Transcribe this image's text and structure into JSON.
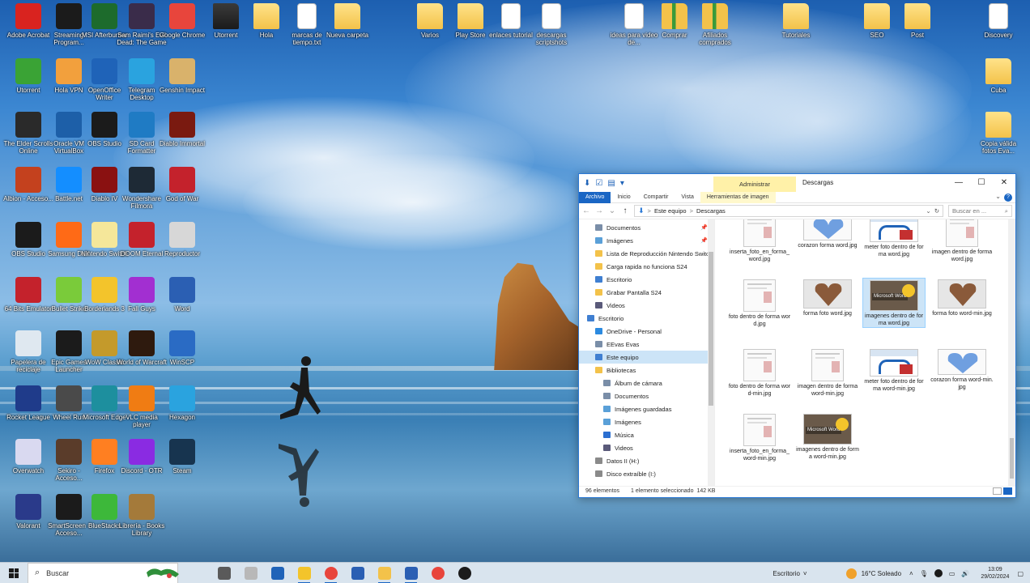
{
  "desktop_icons": [
    {
      "label": "Adobe Acrobat",
      "icon": "acrobat-icon",
      "color": "#d9231f"
    },
    {
      "label": "Streaming Program...",
      "icon": "streaming-icon",
      "color": "#1b1b1b"
    },
    {
      "label": "MSI Afterburner",
      "icon": "msi-afterburner-icon",
      "color": "#1d6b2c"
    },
    {
      "label": "Sam Raimi's Evil Dead: The Game",
      "icon": "game-icon",
      "color": "#3a2c4a"
    },
    {
      "label": "Google Chrome",
      "icon": "chrome-icon",
      "color": "#e8453c"
    },
    {
      "label": "Utorrent",
      "icon": "utorrent-icon",
      "color": "#3aa335"
    },
    {
      "label": "Hola VPN",
      "icon": "hola-icon",
      "color": "#f2a03d"
    },
    {
      "label": "OpenOffice Writer",
      "icon": "openoffice-icon",
      "color": "#1f63b8"
    },
    {
      "label": "Telegram Desktop",
      "icon": "telegram-icon",
      "color": "#2aa3df"
    },
    {
      "label": "Genshin Impact",
      "icon": "genshin-icon",
      "color": "#d9b26b"
    },
    {
      "label": "The Elder Scrolls Online",
      "icon": "eso-icon",
      "color": "#2a2a2a"
    },
    {
      "label": "Oracle VM VirtualBox",
      "icon": "virtualbox-icon",
      "color": "#1d5fa8"
    },
    {
      "label": "OBS Studio",
      "icon": "obs-icon",
      "color": "#1b1b1b"
    },
    {
      "label": "SD Card Formatter",
      "icon": "sd-card-icon",
      "color": "#1f7bc4"
    },
    {
      "label": "Diablo Immortal",
      "icon": "diablo-icon",
      "color": "#7a1a10"
    },
    {
      "label": "Albion - Acceso...",
      "icon": "albion-icon",
      "color": "#c4411e"
    },
    {
      "label": "Battle.net",
      "icon": "battlenet-icon",
      "color": "#148eff"
    },
    {
      "label": "Diablo IV",
      "icon": "diablo-iv-icon",
      "color": "#8a1111"
    },
    {
      "label": "Wondershare Filmora",
      "icon": "filmora-icon",
      "color": "#1e2a36"
    },
    {
      "label": "God of War",
      "icon": "god-of-war-icon",
      "color": "#c4222c"
    },
    {
      "label": "OBS Studio",
      "icon": "obs-studio-icon",
      "color": "#1b1b1b"
    },
    {
      "label": "Samsung DeX",
      "icon": "dex-icon",
      "color": "#ff6a16"
    },
    {
      "label": "Nintendo Switch",
      "icon": "switch-icon",
      "color": "#f5e79a"
    },
    {
      "label": "DOOM Eternal",
      "icon": "doom-icon",
      "color": "#c4222c"
    },
    {
      "label": "Reproductor",
      "icon": "cd-icon",
      "color": "#d7d7d7"
    },
    {
      "label": "64 Bits Emulator",
      "icon": "emulator-64-icon",
      "color": "#c4222c"
    },
    {
      "label": "Bullet Strike",
      "icon": "cube-icon",
      "color": "#7acb3a"
    },
    {
      "label": "Borderlands 3",
      "icon": "borderlands-icon",
      "color": "#f3c42b"
    },
    {
      "label": "Fall Guys",
      "icon": "fall-guys-icon",
      "color": "#a22fd1"
    },
    {
      "label": "Word",
      "icon": "word-icon",
      "color": "#2b5fb3"
    },
    {
      "label": "Papelera de reciclaje",
      "icon": "recycle-bin-icon",
      "color": "#dfe8f0"
    },
    {
      "label": "Epic Games Launcher",
      "icon": "epic-games-icon",
      "color": "#1b1b1b"
    },
    {
      "label": "WoW Classic",
      "icon": "wow-icon",
      "color": "#c49a2b"
    },
    {
      "label": "World of Warcraft",
      "icon": "warcraft-icon",
      "color": "#2e1a0e"
    },
    {
      "label": "WinSCP",
      "icon": "winscp-icon",
      "color": "#2a6bc4"
    },
    {
      "label": "Rocket League",
      "icon": "rocket-league-icon",
      "color": "#1f3b8a"
    },
    {
      "label": "Wheel Run",
      "icon": "wheel-icon",
      "color": "#4a4a4a"
    },
    {
      "label": "Microsoft Edge",
      "icon": "edge-icon",
      "color": "#1d8f9e"
    },
    {
      "label": "VLC media player",
      "icon": "vlc-icon",
      "color": "#f07c13"
    },
    {
      "label": "Hexagon",
      "icon": "hexagon-icon",
      "color": "#2aa3df"
    },
    {
      "label": "Overwatch",
      "icon": "overwatch-icon",
      "color": "#d9d9f0"
    },
    {
      "label": "Sekiro - Acceso...",
      "icon": "sekiro-icon",
      "color": "#5a3c2a"
    },
    {
      "label": "Firefox",
      "icon": "firefox-icon",
      "color": "#ff7f21"
    },
    {
      "label": "Discord - OTR",
      "icon": "discord-icon",
      "color": "#8a2be2"
    },
    {
      "label": "Steam",
      "icon": "steam-icon",
      "color": "#17344f"
    },
    {
      "label": "Valorant",
      "icon": "valorant-icon",
      "color": "#2a3a8a"
    },
    {
      "label": "SmartScreen - Acceso...",
      "icon": "smart-icon",
      "color": "#1b1b1b"
    },
    {
      "label": "BlueStacks",
      "icon": "bluestacks-icon",
      "color": "#3db83a"
    },
    {
      "label": "Librería - Books Library",
      "icon": "books-icon",
      "color": "#a47a3a"
    }
  ],
  "desktop_files": [
    {
      "label": "Utorrent",
      "kind": "folder-dark"
    },
    {
      "label": "Hola",
      "kind": "folder-doc"
    },
    {
      "label": "marcas de tiempo.txt",
      "kind": "doc"
    },
    {
      "label": "Nueva carpeta",
      "kind": "folder-doc"
    },
    {
      "label": "Varios",
      "kind": "folder"
    },
    {
      "label": "Play Store",
      "kind": "folder"
    },
    {
      "label": "enlaces tutorial",
      "kind": "doc"
    },
    {
      "label": "descargas scriptshots",
      "kind": "doc"
    },
    {
      "label": "ideas para video de...",
      "kind": "doc"
    },
    {
      "label": "Comprar",
      "kind": "zip"
    },
    {
      "label": "Afiliados comprados",
      "kind": "zip"
    },
    {
      "label": "Tutoriales",
      "kind": "folder"
    },
    {
      "label": "SEO",
      "kind": "folder"
    },
    {
      "label": "Post",
      "kind": "folder"
    },
    {
      "label": "Discovery",
      "kind": "doc"
    },
    {
      "label": "Cuba",
      "kind": "folder"
    },
    {
      "label": "Copia válida fotos Eva...",
      "kind": "folder"
    }
  ],
  "explorer": {
    "qa_icons": [
      "⬇",
      "☑",
      "▤",
      "▾"
    ],
    "manage_tab": "Administrar",
    "title": "Descargas",
    "controls": [
      "—",
      "☐",
      "✕"
    ],
    "ribbon_tabs": [
      "Archivo",
      "Inicio",
      "Compartir",
      "Vista",
      "Herramientas de imagen"
    ],
    "ribbon_caret": "⌄",
    "help": "?",
    "nav_back": "←",
    "nav_forward": "→",
    "nav_recent": "⌄",
    "nav_up": "↑",
    "address": [
      "Este equipo",
      "Descargas"
    ],
    "address_sep": ">",
    "address_dropdown": "⌄",
    "refresh": "↻",
    "search_placeholder": "Buscar en ...",
    "search_icon": "⌕",
    "pin": "📌",
    "nav_items": [
      {
        "label": "Documentos",
        "pinned": true,
        "color": "#7a8ea8",
        "indent": 1
      },
      {
        "label": "Imágenes",
        "pinned": true,
        "color": "#5aa0d8",
        "indent": 1
      },
      {
        "label": "Lista de Reproducción Nintendo Switch",
        "pinned": true,
        "color": "#f3c24a",
        "indent": 1
      },
      {
        "label": "Carga rapida no funciona S24",
        "pinned": false,
        "color": "#f3c24a",
        "indent": 1
      },
      {
        "label": "Escritorio",
        "pinned": false,
        "color": "#3f7fd1",
        "indent": 1
      },
      {
        "label": "Grabar Pantalla S24",
        "pinned": false,
        "color": "#f3c24a",
        "indent": 1
      },
      {
        "label": "Videos",
        "pinned": false,
        "color": "#5a5a7a",
        "indent": 1
      },
      {
        "label": "Escritorio",
        "pinned": false,
        "color": "#3f7fd1",
        "indent": 0
      },
      {
        "label": "OneDrive - Personal",
        "pinned": false,
        "color": "#2b8ae0",
        "indent": 1
      },
      {
        "label": "EEvas Evas",
        "pinned": false,
        "color": "#7a8ea8",
        "indent": 1
      },
      {
        "label": "Este equipo",
        "pinned": false,
        "color": "#3f7fd1",
        "indent": 1,
        "selected": true
      },
      {
        "label": "Bibliotecas",
        "pinned": false,
        "color": "#f3c24a",
        "indent": 1
      },
      {
        "label": "Álbum de cámara",
        "pinned": false,
        "color": "#7a8ea8",
        "indent": 2
      },
      {
        "label": "Documentos",
        "pinned": false,
        "color": "#7a8ea8",
        "indent": 2
      },
      {
        "label": "Imágenes guardadas",
        "pinned": false,
        "color": "#5aa0d8",
        "indent": 2
      },
      {
        "label": "Imágenes",
        "pinned": false,
        "color": "#5aa0d8",
        "indent": 2
      },
      {
        "label": "Música",
        "pinned": false,
        "color": "#2b6fd1",
        "indent": 2
      },
      {
        "label": "Videos",
        "pinned": false,
        "color": "#5a5a7a",
        "indent": 2
      },
      {
        "label": "Datos II (H:)",
        "pinned": false,
        "color": "#8a8a8a",
        "indent": 1
      },
      {
        "label": "Disco extraíble (I:)",
        "pinned": false,
        "color": "#8a8a8a",
        "indent": 1
      }
    ],
    "files": [
      {
        "name": "inserta_foto_en_forma_word.jpg",
        "thumb": "page",
        "selected": false
      },
      {
        "name": "corazon forma word.jpg",
        "thumb": "heart",
        "selected": false
      },
      {
        "name": "meter foto dentro de forma word.jpg",
        "thumb": "shape",
        "selected": false
      },
      {
        "name": "imagen dentro de forma word.jpg",
        "thumb": "page",
        "selected": false
      },
      {
        "name": "foto dentro de forma word.jpg",
        "thumb": "page",
        "selected": false
      },
      {
        "name": "forma foto word.jpg",
        "thumb": "photo-heart",
        "selected": false
      },
      {
        "name": "imagenes dentro de forma word.jpg",
        "thumb": "word-emoji",
        "selected": true
      },
      {
        "name": "forma foto word-min.jpg",
        "thumb": "photo-heart",
        "selected": false
      },
      {
        "name": "foto dentro de forma word-min.jpg",
        "thumb": "page",
        "selected": false
      },
      {
        "name": "imagen dentro de forma word-min.jpg",
        "thumb": "page",
        "selected": false
      },
      {
        "name": "meter foto dentro de forma word-min.jpg",
        "thumb": "shape",
        "selected": false
      },
      {
        "name": "corazon forma word-min.jpg",
        "thumb": "heart",
        "selected": false
      },
      {
        "name": "inserta_foto_en_forma_word-min.jpg",
        "thumb": "page",
        "selected": false
      },
      {
        "name": "imagenes dentro de forma word-min.jpg",
        "thumb": "word-emoji",
        "selected": false
      }
    ],
    "thumb_label": "Microsoft Word",
    "status": {
      "count": "96 elementos",
      "selection": "1 elemento seleccionado",
      "size": "142 KB"
    }
  },
  "taskbar": {
    "search_placeholder": "Buscar",
    "search_icon": "⌕",
    "apps": [
      {
        "name": "task-view",
        "color": "#5a5a5a"
      },
      {
        "name": "pen-app",
        "color": "#b8b8b8"
      },
      {
        "name": "store",
        "color": "#1f63b8"
      },
      {
        "name": "notes-app",
        "color": "#f3c42b"
      },
      {
        "name": "chrome",
        "color": "#e8453c"
      },
      {
        "name": "remote-desktop",
        "color": "#2a5fb3"
      },
      {
        "name": "file-explorer",
        "color": "#f3c24a"
      },
      {
        "name": "word",
        "color": "#2b5fb3"
      },
      {
        "name": "chrome-2",
        "color": "#e8453c"
      },
      {
        "name": "obs",
        "color": "#1b1b1b"
      }
    ],
    "desktop_label": "Escritorio",
    "desktop_caret": "˅",
    "weather": "16°C  Soleado",
    "time": "13:09",
    "date": "29/02/2024"
  }
}
